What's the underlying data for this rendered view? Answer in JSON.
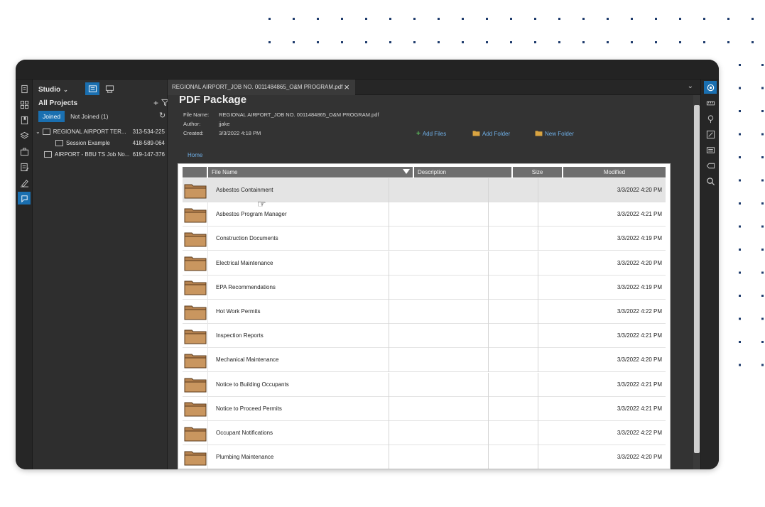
{
  "studio": {
    "label": "Studio",
    "all_projects": "All Projects",
    "tab_joined": "Joined",
    "tab_not_joined": "Not Joined (1)",
    "projects": [
      {
        "name": "REGIONAL AIRPORT TER...",
        "id": "313-534-225"
      },
      {
        "name": "Session Example",
        "id": "418-589-064"
      },
      {
        "name": "AIRPORT - BBU TS Job No...",
        "id": "619-147-376"
      }
    ]
  },
  "document": {
    "tab_title": "REGIONAL AIRPORT_JOB NO. 0011484865_O&M PROGRAM.pdf",
    "package_title": "PDF Package",
    "meta": {
      "file_name_label": "File Name:",
      "file_name": "REGIONAL AIRPORT_JOB NO. 0011484865_O&M PROGRAM.pdf",
      "author_label": "Author:",
      "author": "jjake",
      "created_label": "Created:",
      "created": "3/3/2022 4:18 PM"
    },
    "actions": {
      "add_files": "Add Files",
      "add_folder": "Add Folder",
      "new_folder": "New Folder"
    },
    "home_link": "Home",
    "columns": {
      "file_name": "File Name",
      "description": "Description",
      "size": "Size",
      "modified": "Modified"
    },
    "rows": [
      {
        "name": "Asbestos Containment",
        "modified": "3/3/2022 4:20 PM"
      },
      {
        "name": "Asbestos Program Manager",
        "modified": "3/3/2022 4:21 PM"
      },
      {
        "name": "Construction Documents",
        "modified": "3/3/2022 4:19 PM"
      },
      {
        "name": "Electrical Maintenance",
        "modified": "3/3/2022 4:20 PM"
      },
      {
        "name": "EPA Recommendations",
        "modified": "3/3/2022 4:19 PM"
      },
      {
        "name": "Hot Work Permits",
        "modified": "3/3/2022 4:22 PM"
      },
      {
        "name": "Inspection Reports",
        "modified": "3/3/2022 4:21 PM"
      },
      {
        "name": "Mechanical Maintenance",
        "modified": "3/3/2022 4:20 PM"
      },
      {
        "name": "Notice to Building Occupants",
        "modified": "3/3/2022 4:21 PM"
      },
      {
        "name": "Notice to Proceed Permits",
        "modified": "3/3/2022 4:21 PM"
      },
      {
        "name": "Occupant Notifications",
        "modified": "3/3/2022 4:22 PM"
      },
      {
        "name": "Plumbing Maintenance",
        "modified": "3/3/2022 4:20 PM"
      }
    ]
  },
  "colors": {
    "accent": "#1a6fb0",
    "link": "#6fb0e8",
    "folder": "#b5824f"
  }
}
